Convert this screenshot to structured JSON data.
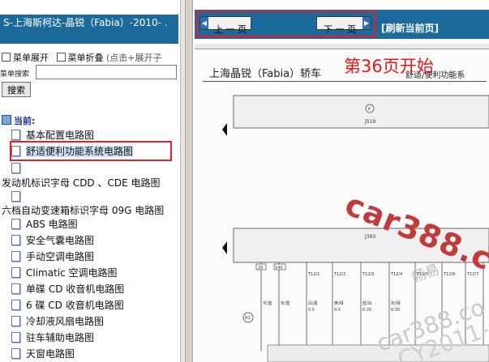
{
  "left": {
    "title": "S-上海斯柯达-晶锐（Fabia）-2010- .",
    "menu_expand": "菜单展开",
    "menu_collapse": "菜单折叠",
    "menu_hint": "(点击+展开子",
    "search_label": "菜单搜索",
    "search_value": "",
    "search_button": "搜索",
    "current_label": "当前:",
    "tree": {
      "basic_config": "基本配置电路图",
      "comfort": "舒适便利功能系统电路图",
      "engine_group": "发动机标识字母 CDD 、CDE 电路图",
      "gearbox_group": "六档自动变速箱标识字母 09G 电路图",
      "abs": "ABS 电路图",
      "airbag": "安全气囊电路图",
      "manual_ac": "手动空调电路图",
      "climatic": "Climatic 空调电路图",
      "single_cd": "单碟 CD 收音机电路图",
      "six_cd": "6 碟 CD 收音机电路图",
      "cooling_fan": "冷却液风扇电路图",
      "parking_aid": "驻车辅助电路图",
      "sunroof": "天窗电路图"
    }
  },
  "nav": {
    "prev": "上 一 页",
    "next": "下 一 页",
    "refresh": "[刷新当前页]"
  },
  "doc": {
    "title": "上海晶锐（Fabia）轿车",
    "subtitle": "舒适/便利功能系",
    "page_note": "第36页开始",
    "watermark_main": "car388.com",
    "watermark_cn": "畅易",
    "watermark_ghost1": "car388.co",
    "watermark_ghost2": "CY2011-",
    "diagram": {
      "top_module": "J519",
      "bottom_module": "J393",
      "circle_label": "K",
      "connectors": [
        "T12/1",
        "T12/2",
        "T12/3",
        "T12/4",
        "T12/5",
        "T12/6",
        "T12/7"
      ],
      "fuses": [
        "20",
        "140"
      ],
      "relay": "R1",
      "wire_colors": [
        "灰/蓝",
        "灰/蓝",
        "白/黑",
        "黄/绿",
        "蓝/白",
        "灰/绿"
      ],
      "wire_sizes": [
        "0.5",
        "0.35"
      ]
    }
  },
  "colors": {
    "title_bar": "#1c6a9a",
    "highlight": "#e0202a",
    "watermark": "#c23b3b",
    "page_note": "#e5171d"
  }
}
